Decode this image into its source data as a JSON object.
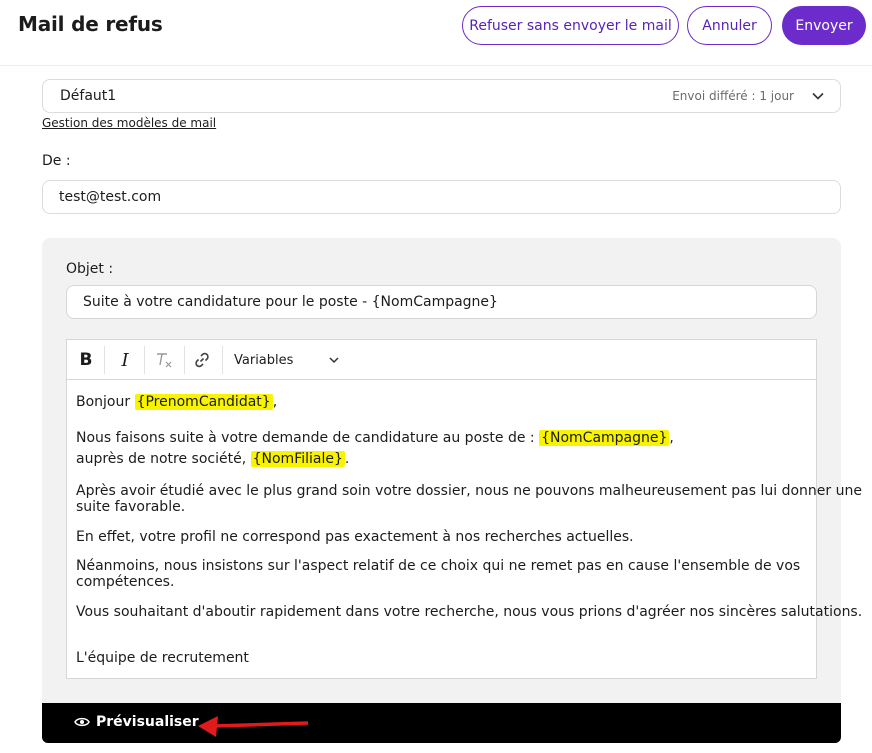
{
  "header": {
    "title": "Mail de refus",
    "refuse_no_mail_label": "Refuser sans envoyer le mail",
    "cancel_label": "Annuler",
    "send_label": "Envoyer"
  },
  "template_select": {
    "value": "Défaut1",
    "delay_text": "Envoi différé : 1 jour",
    "manage_link": "Gestion des modèles de mail"
  },
  "from": {
    "label": "De :",
    "value": "test@test.com"
  },
  "subject": {
    "label": "Objet :",
    "value": "Suite à votre candidature pour le poste - {NomCampagne}"
  },
  "toolbar": {
    "bold": "B",
    "italic": "I",
    "variables_label": "Variables",
    "icons": [
      "bold-icon",
      "italic-icon",
      "clear-format-icon",
      "link-icon",
      "chevron-down-icon"
    ]
  },
  "body": {
    "greeting": "Bonjour ",
    "greeting_var": "{PrenomCandidat}",
    "greeting_end": ",",
    "p1_text": "Nous faisons suite à votre demande de candidature au poste de : ",
    "p1_var": "{NomCampagne}",
    "p1_end": ",",
    "p1b_text": "auprès de notre société, ",
    "p1b_var": "{NomFiliale}",
    "p1b_end": ".",
    "p2_line1": "Après avoir étudié avec le plus grand soin votre dossier, nous ne pouvons malheureusement pas lui donner une",
    "p2_line2": "suite favorable.",
    "p3": "En effet, votre profil ne correspond pas exactement à nos recherches actuelles.",
    "p4_line1": "Néanmoins, nous insistons sur l'aspect relatif de ce choix qui ne remet pas en cause l'ensemble de vos",
    "p4_line2": "compétences.",
    "p5": "Vous souhaitant d'aboutir rapidement dans votre recherche, nous vous prions d'agréer nos sincères salutations.",
    "signature": "L'équipe de recrutement"
  },
  "preview": {
    "label": "Prévisualiser"
  },
  "colors": {
    "accent": "#6b2ccb",
    "variable_highlight": "#f8f400",
    "arrow": "#e01b1b"
  }
}
